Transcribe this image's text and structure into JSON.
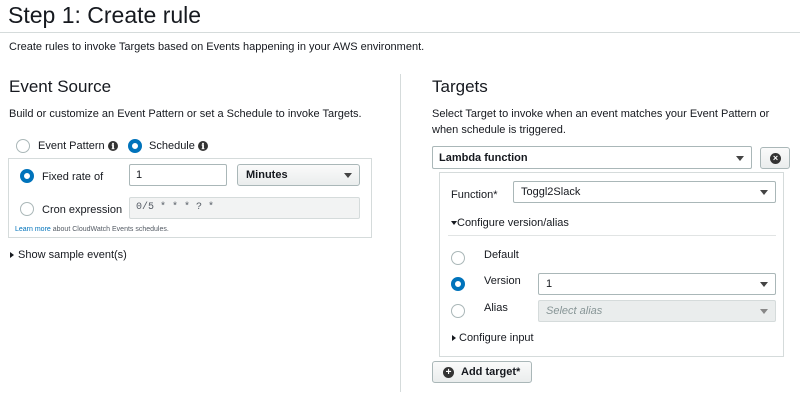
{
  "page": {
    "title": "Step 1: Create rule",
    "description": "Create rules to invoke Targets based on Events happening in your AWS environment."
  },
  "event_source": {
    "title": "Event Source",
    "description": "Build or customize an Event Pattern or set a Schedule to invoke Targets.",
    "options": [
      {
        "label": "Event Pattern",
        "info_icon": "ℹ",
        "selected": false
      },
      {
        "label": "Schedule",
        "info_icon": "ℹ",
        "selected": true
      }
    ],
    "fixed_rate": {
      "label": "Fixed rate of",
      "selected": true,
      "value": "1",
      "unit": "Minutes"
    },
    "cron": {
      "label": "Cron expression",
      "selected": false,
      "placeholder": "0/5 * * * ? *"
    },
    "learn_more_link": "Learn more",
    "learn_more_text": " about CloudWatch Events schedules.",
    "sample_events": "Show sample event(s)"
  },
  "targets": {
    "title": "Targets",
    "description": "Select Target to invoke when an event matches your Event Pattern or when schedule is triggered.",
    "target_type": "Lambda function",
    "remove_icon": "×",
    "function_label": "Function*",
    "function_value": "Toggl2Slack",
    "configure_version": "Configure version/alias",
    "version_options": [
      {
        "label": "Default",
        "selected": false
      },
      {
        "label": "Version",
        "selected": true
      },
      {
        "label": "Alias",
        "selected": false
      }
    ],
    "version_value": "1",
    "alias_placeholder": "Select alias",
    "configure_input": "Configure input",
    "add_target": "Add target*",
    "add_icon": "+"
  },
  "colors": {
    "accent": "#0073bb",
    "border": "#aab7b8"
  }
}
